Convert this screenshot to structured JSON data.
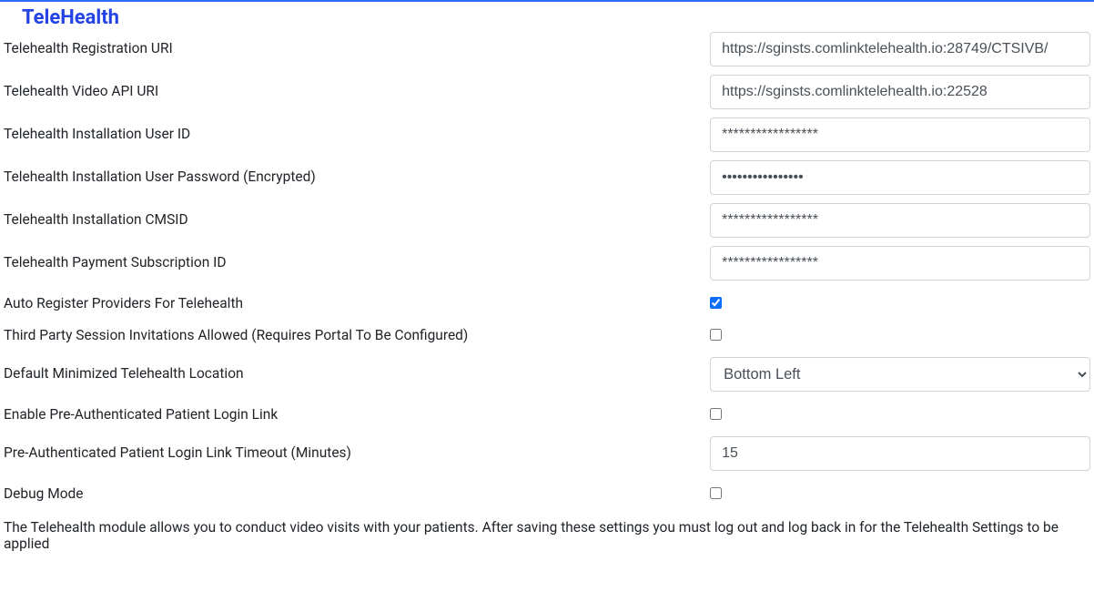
{
  "section": {
    "title": "TeleHealth"
  },
  "fields": {
    "registration_uri": {
      "label": "Telehealth Registration URI",
      "value": "https://sginsts.comlinktelehealth.io:28749/CTSIVB/"
    },
    "video_api_uri": {
      "label": "Telehealth Video API URI",
      "value": "https://sginsts.comlinktelehealth.io:22528"
    },
    "install_user_id": {
      "label": "Telehealth Installation User ID",
      "value": "*****************"
    },
    "install_user_pw": {
      "label": "Telehealth Installation User Password (Encrypted)",
      "value": "••••••••••••••••"
    },
    "install_cmsid": {
      "label": "Telehealth Installation CMSID",
      "value": "*****************"
    },
    "payment_sub_id": {
      "label": "Telehealth Payment Subscription ID",
      "value": "*****************"
    },
    "auto_register": {
      "label": "Auto Register Providers For Telehealth"
    },
    "third_party": {
      "label": "Third Party Session Invitations Allowed (Requires Portal To Be Configured)"
    },
    "min_location": {
      "label": "Default Minimized Telehealth Location",
      "value": "Bottom Left"
    },
    "preauth_link": {
      "label": "Enable Pre-Authenticated Patient Login Link"
    },
    "preauth_timeout": {
      "label": "Pre-Authenticated Patient Login Link Timeout (Minutes)",
      "value": "15"
    },
    "debug_mode": {
      "label": "Debug Mode"
    }
  },
  "description": "The Telehealth module allows you to conduct video visits with your patients. After saving these settings you must log out and log back in for the Telehealth Settings to be applied"
}
